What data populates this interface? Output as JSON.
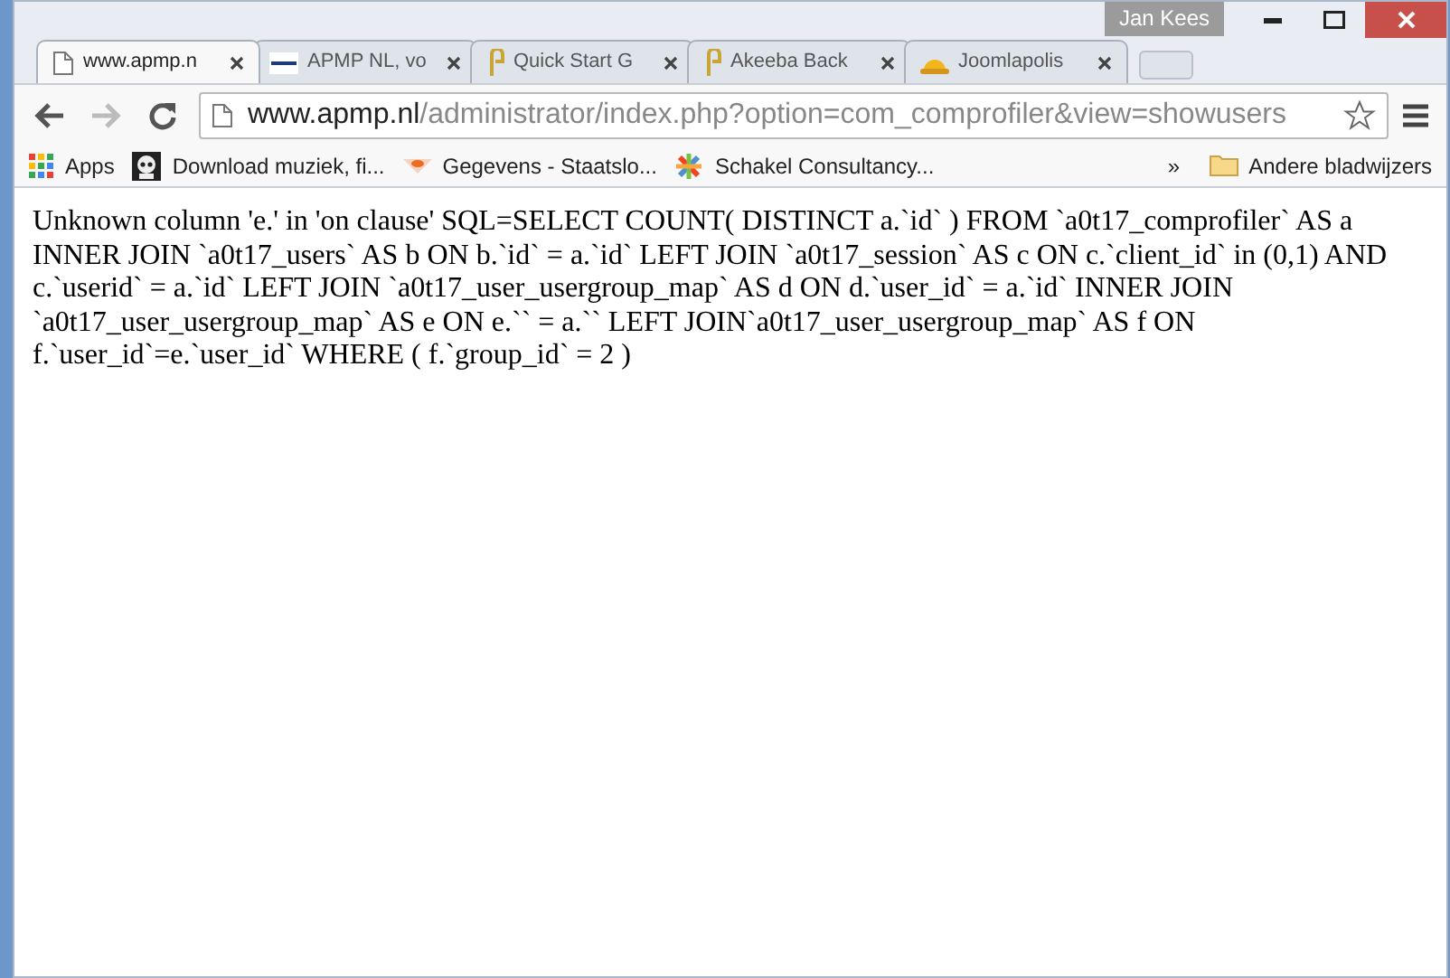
{
  "window": {
    "user": "Jan Kees"
  },
  "tabs": [
    {
      "title": "www.apmp.n",
      "selected": true
    },
    {
      "title": "APMP NL, vo",
      "selected": false
    },
    {
      "title": "Quick Start G",
      "selected": false
    },
    {
      "title": "Akeeba Back",
      "selected": false
    },
    {
      "title": "Joomlapolis",
      "selected": false
    }
  ],
  "address_bar": {
    "host": "www.apmp.nl",
    "path": "/administrator/index.php?option=com_comprofiler&view=showusers"
  },
  "bookmarks": [
    {
      "label": "Apps"
    },
    {
      "label": "Download muziek, fi..."
    },
    {
      "label": "Gegevens - Staatslo..."
    },
    {
      "label": "Schakel Consultancy..."
    }
  ],
  "bookmarks_more": "»",
  "other_bookmarks": "Andere bladwijzers",
  "content": {
    "error": "Unknown column 'e.' in 'on clause' SQL=SELECT COUNT( DISTINCT a.`id` ) FROM `a0t17_comprofiler` AS a INNER JOIN `a0t17_users` AS b ON b.`id` = a.`id` LEFT JOIN `a0t17_session` AS c ON c.`client_id` in (0,1) AND c.`userid` = a.`id` LEFT JOIN `a0t17_user_usergroup_map` AS d ON d.`user_id` = a.`id` INNER JOIN `a0t17_user_usergroup_map` AS e ON e.`` = a.`` LEFT JOIN`a0t17_user_usergroup_map` AS f ON f.`user_id`=e.`user_id` WHERE ( f.`group_id` = 2 )"
  }
}
